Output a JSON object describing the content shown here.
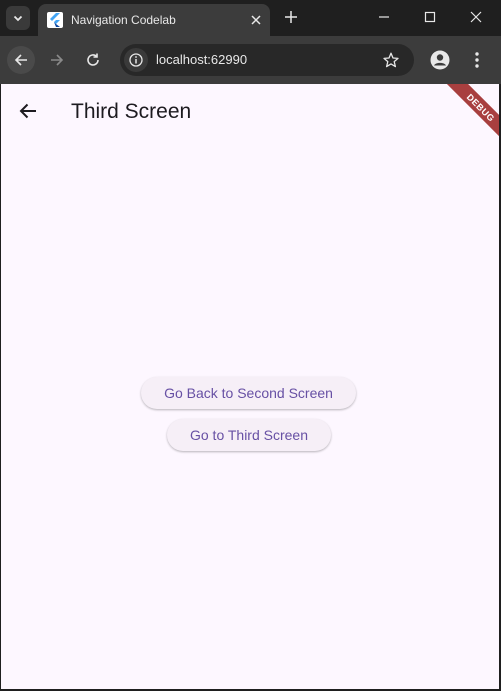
{
  "browser": {
    "tab": {
      "title": "Navigation Codelab",
      "favicon": "flutter-icon"
    },
    "new_tab_icon": "plus-icon",
    "address_bar": {
      "url": "localhost:62990"
    },
    "window_controls": [
      "minimize-icon",
      "maximize-icon",
      "close-icon"
    ]
  },
  "app": {
    "title": "Third Screen",
    "debug_banner": "DEBUG",
    "buttons": {
      "go_back_second": "Go Back to Second Screen",
      "go_third": "Go to Third Screen"
    }
  },
  "colors": {
    "background": "#fdf7ff",
    "button_bg": "#f6eff7",
    "button_text": "#6750a4",
    "debug_banner": "#a83f3f"
  }
}
